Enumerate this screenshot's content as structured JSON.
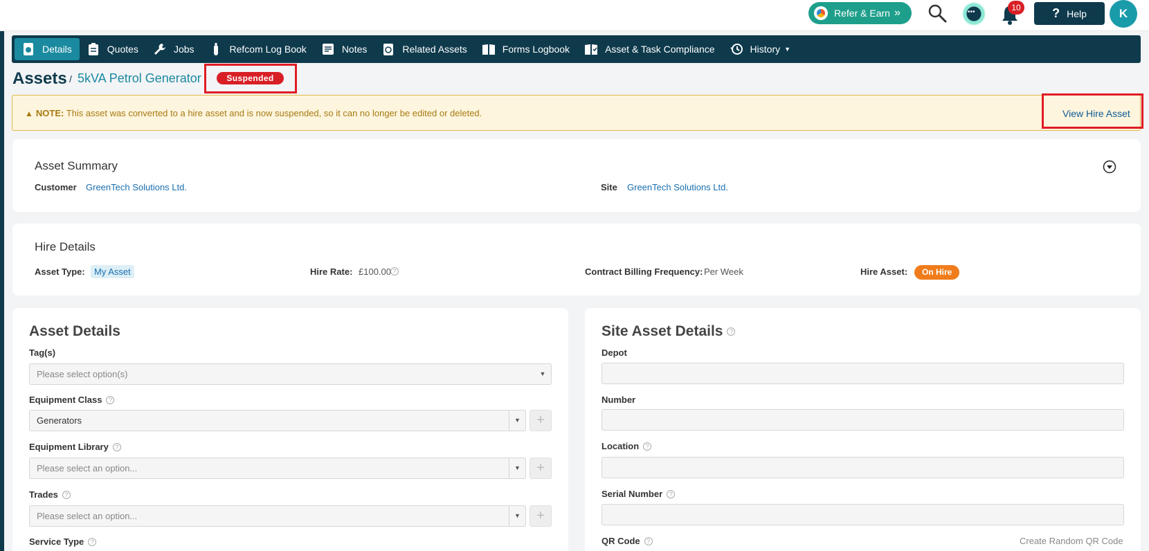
{
  "topbar": {
    "refer_label": "Refer & Earn",
    "refer_arrows": "»",
    "notifications_count": "10",
    "help_label": "Help",
    "help_glyph": "?",
    "avatar_initial": "K"
  },
  "nav": {
    "items": [
      {
        "label": "Details",
        "icon": "document-icon",
        "active": true
      },
      {
        "label": "Quotes",
        "icon": "clipboard-icon"
      },
      {
        "label": "Jobs",
        "icon": "wrench-icon"
      },
      {
        "label": "Refcom Log Book",
        "icon": "cylinder-icon"
      },
      {
        "label": "Notes",
        "icon": "note-icon"
      },
      {
        "label": "Related Assets",
        "icon": "asset-icon"
      },
      {
        "label": "Forms Logbook",
        "icon": "book-icon"
      },
      {
        "label": "Asset & Task Compliance",
        "icon": "book-check-icon"
      },
      {
        "label": "History",
        "icon": "history-icon"
      }
    ],
    "history_caret": "▼"
  },
  "header": {
    "title": "Assets",
    "separator": "/",
    "asset_name": "5kVA Petrol Generator",
    "status": "Suspended"
  },
  "note": {
    "icon": "▲",
    "prefix": "NOTE:",
    "message": "This asset was converted to a hire asset and is now suspended, so it can no longer be edited or deleted.",
    "action": "View Hire Asset"
  },
  "asset_summary": {
    "title": "Asset Summary",
    "customer_label": "Customer",
    "customer_value": "GreenTech Solutions Ltd.",
    "site_label": "Site",
    "site_value": "GreenTech Solutions Ltd."
  },
  "hire_details": {
    "title": "Hire Details",
    "asset_type_label": "Asset Type:",
    "asset_type_value": "My Asset",
    "hire_rate_label": "Hire Rate:",
    "hire_rate_value": "£100.00",
    "billing_label": "Contract Billing Frequency:",
    "billing_value": "Per Week",
    "hire_asset_label": "Hire Asset:",
    "hire_asset_value": "On Hire"
  },
  "asset_details": {
    "title": "Asset Details",
    "tags_label": "Tag(s)",
    "tags_placeholder": "Please select option(s)",
    "equipment_class_label": "Equipment Class",
    "equipment_class_value": "Generators",
    "equipment_library_label": "Equipment Library",
    "equipment_library_placeholder": "Please select an option...",
    "trades_label": "Trades",
    "trades_placeholder": "Please select an option...",
    "service_type_label": "Service Type",
    "plus_glyph": "+",
    "dropdown_glyph": "▼"
  },
  "site_asset_details": {
    "title": "Site Asset Details",
    "depot_label": "Depot",
    "number_label": "Number",
    "location_label": "Location",
    "serial_label": "Serial Number",
    "qr_label": "QR Code",
    "qr_action": "Create Random QR Code"
  },
  "help_glyph": "?"
}
